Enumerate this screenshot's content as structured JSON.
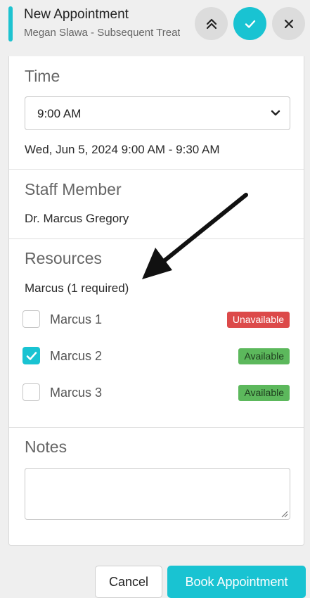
{
  "header": {
    "title": "New Appointment",
    "subtitle": "Megan Slawa - Subsequent Treatment",
    "collapse_icon": "double-chevron-up-icon",
    "confirm_icon": "check-icon",
    "close_icon": "close-icon"
  },
  "time": {
    "section_title": "Time",
    "selected": "9:00 AM",
    "summary": "Wed, Jun 5, 2024 9:00 AM - 9:30 AM"
  },
  "staff": {
    "section_title": "Staff Member",
    "name": "Dr. Marcus Gregory"
  },
  "resources": {
    "section_title": "Resources",
    "group_label": "Marcus (1 required)",
    "items": [
      {
        "label": "Marcus 1",
        "checked": false,
        "status": "Unavailable"
      },
      {
        "label": "Marcus 2",
        "checked": true,
        "status": "Available"
      },
      {
        "label": "Marcus 3",
        "checked": false,
        "status": "Available"
      }
    ]
  },
  "notes": {
    "section_title": "Notes",
    "value": ""
  },
  "footer": {
    "cancel_label": "Cancel",
    "book_label": "Book Appointment"
  },
  "colors": {
    "accent": "#19c3d2",
    "unavailable": "#dc4a4a",
    "available": "#5cb85c"
  }
}
